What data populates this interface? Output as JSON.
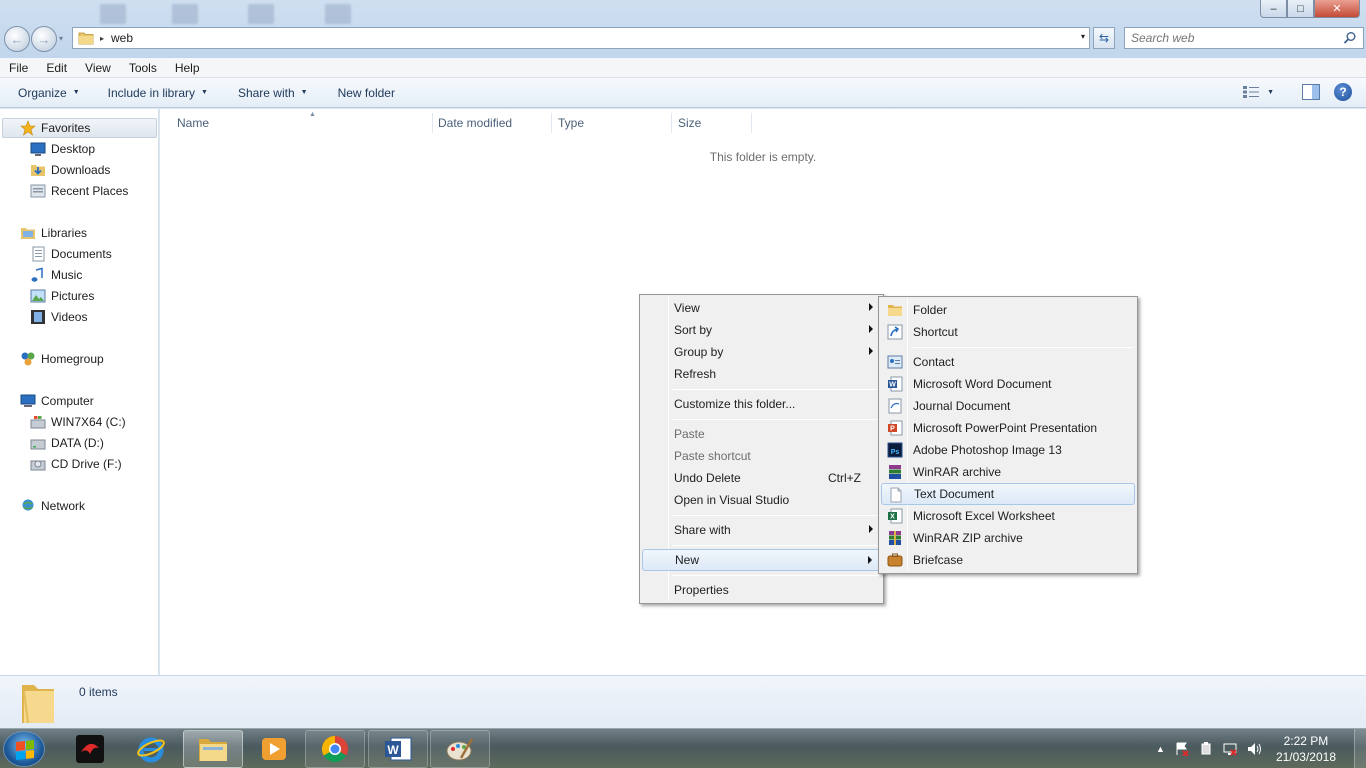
{
  "window": {
    "controls": {
      "minimize": "–",
      "maximize": "□",
      "close": "✕"
    },
    "nav": {
      "back": "←",
      "forward": "→",
      "recent": "▾"
    },
    "address": {
      "crumb": "web",
      "separator": "▸",
      "dropdown": "▾"
    },
    "refresh": "⇆",
    "search": {
      "placeholder": "Search web"
    }
  },
  "menubar": [
    "File",
    "Edit",
    "View",
    "Tools",
    "Help"
  ],
  "toolbar": {
    "organize": "Organize",
    "include": "Include in library",
    "share": "Share with",
    "new_folder": "New folder",
    "arrow": "▼",
    "help": "?"
  },
  "nav_pane": {
    "favorites": "Favorites",
    "desktop": "Desktop",
    "downloads": "Downloads",
    "recent": "Recent Places",
    "libraries": "Libraries",
    "documents": "Documents",
    "music": "Music",
    "pictures": "Pictures",
    "videos": "Videos",
    "homegroup": "Homegroup",
    "computer": "Computer",
    "drive_c": "WIN7X64 (C:)",
    "drive_d": "DATA (D:)",
    "drive_f": "CD Drive (F:)",
    "network": "Network"
  },
  "columns": {
    "name": "Name",
    "date": "Date modified",
    "type": "Type",
    "size": "Size",
    "sort_caret": "▲"
  },
  "empty_message": "This folder is empty.",
  "details": {
    "count": "0 items"
  },
  "context_menu": {
    "view": "View",
    "sort_by": "Sort by",
    "group_by": "Group by",
    "refresh": "Refresh",
    "customize": "Customize this folder...",
    "paste": "Paste",
    "paste_shortcut": "Paste shortcut",
    "undo_delete": "Undo Delete",
    "undo_shortcut": "Ctrl+Z",
    "open_vs": "Open in Visual Studio",
    "share_with": "Share with",
    "new": "New",
    "properties": "Properties"
  },
  "new_submenu": {
    "folder": "Folder",
    "shortcut": "Shortcut",
    "contact": "Contact",
    "word": "Microsoft Word Document",
    "journal": "Journal Document",
    "powerpoint": "Microsoft PowerPoint Presentation",
    "photoshop": "Adobe Photoshop Image 13",
    "winrar": "WinRAR archive",
    "text": "Text Document",
    "excel": "Microsoft Excel Worksheet",
    "winrar_zip": "WinRAR ZIP archive",
    "briefcase": "Briefcase",
    "icon_labels": {
      "word": "W",
      "powerpoint": "P",
      "photoshop": "Ps",
      "excel": "X"
    }
  },
  "taskbar": {
    "word_label": "W",
    "tray_arrow": "▲",
    "clock_time": "2:22 PM",
    "clock_date": "21/03/2018"
  },
  "colors": {
    "highlight_border": "#a8c7ea",
    "taskbar": "#4a5a5e",
    "window_frame": "#c1d6ec"
  }
}
